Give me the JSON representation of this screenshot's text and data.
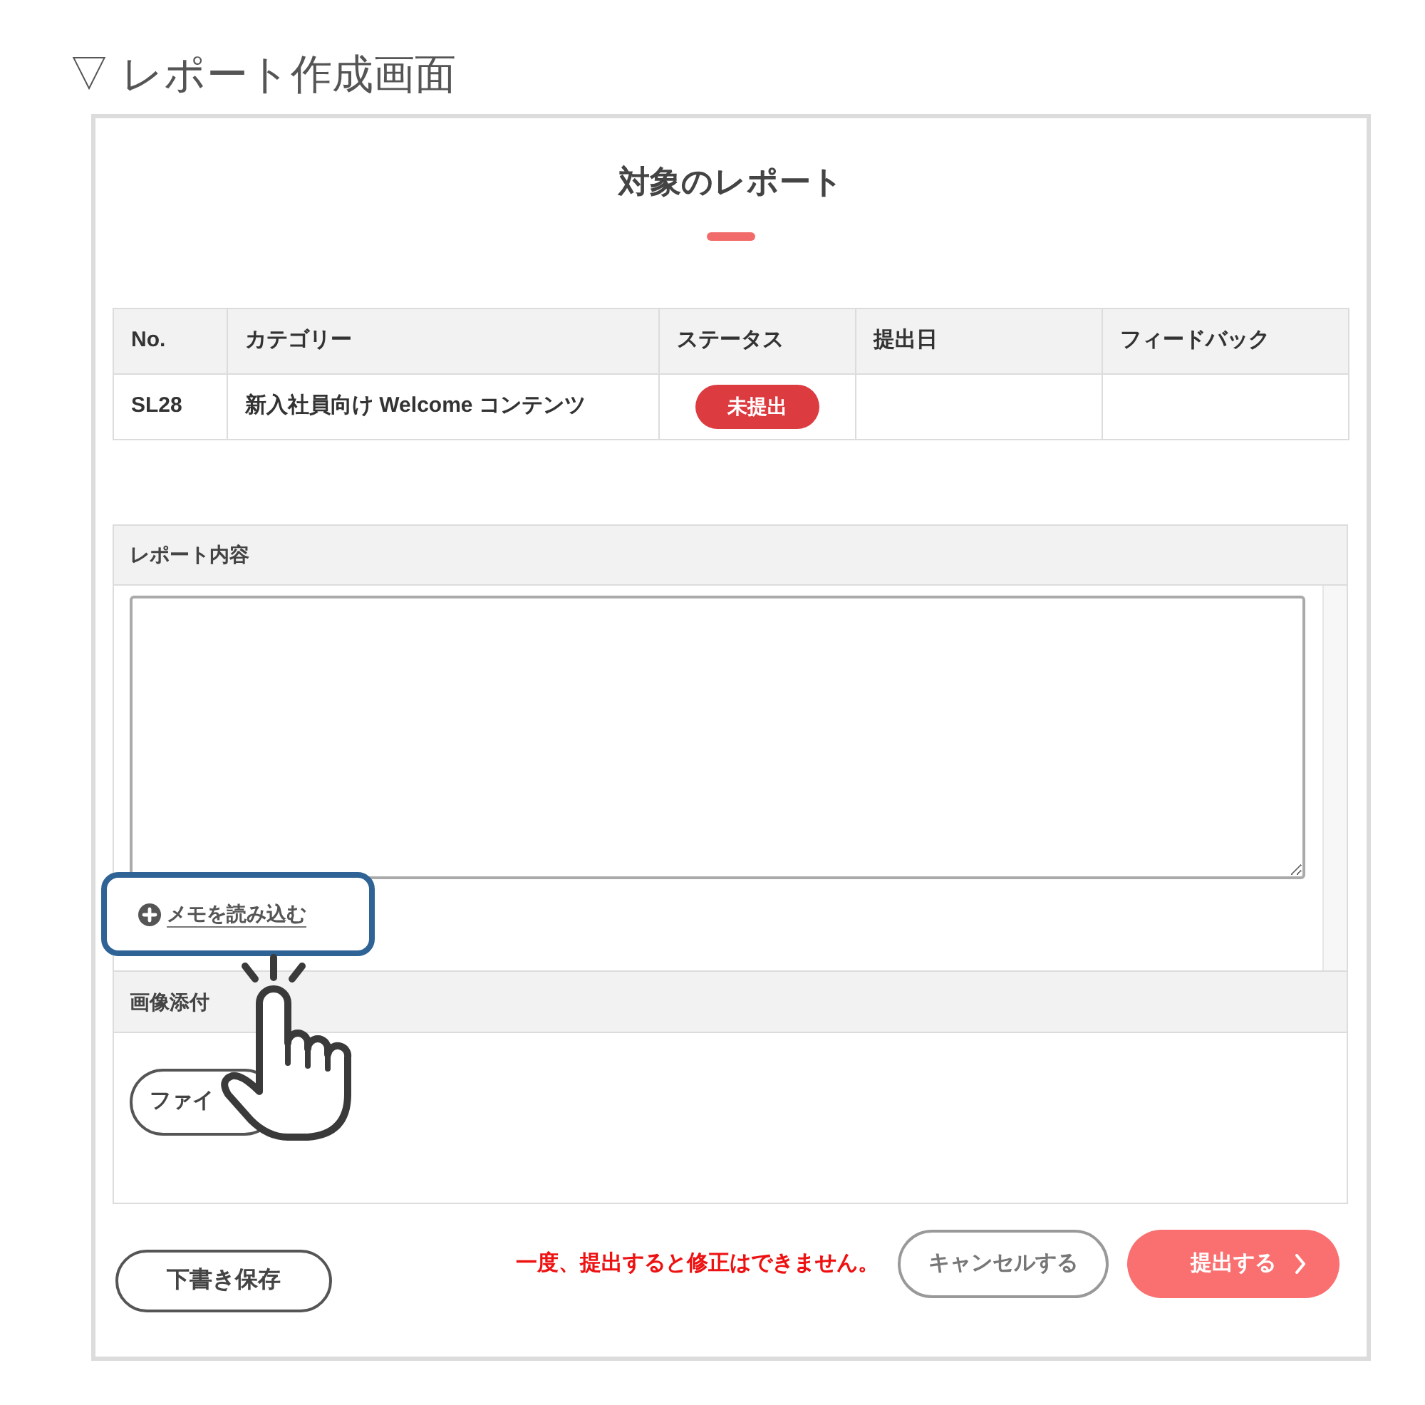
{
  "caption": "▽ レポート作成画面",
  "title": "対象のレポート",
  "table": {
    "columns": [
      "No.",
      "カテゴリー",
      "ステータス",
      "提出日",
      "フィードバック"
    ],
    "rows": [
      {
        "no": "SL28",
        "category": "新入社員向け Welcome コンテンツ",
        "status": "未提出"
      }
    ]
  },
  "report_content": {
    "label": "レポート内容",
    "memo_link": {
      "label": "メモを読み込む",
      "highlighted": true
    }
  },
  "image_attachment": {
    "label": "画像添付",
    "file_button": "ファイ"
  },
  "footer": {
    "draft_button": "下書き保存",
    "warning": "一度、提出すると修正はできません。",
    "cancel_button": "キャンセルする",
    "submit_button": "提出する"
  }
}
